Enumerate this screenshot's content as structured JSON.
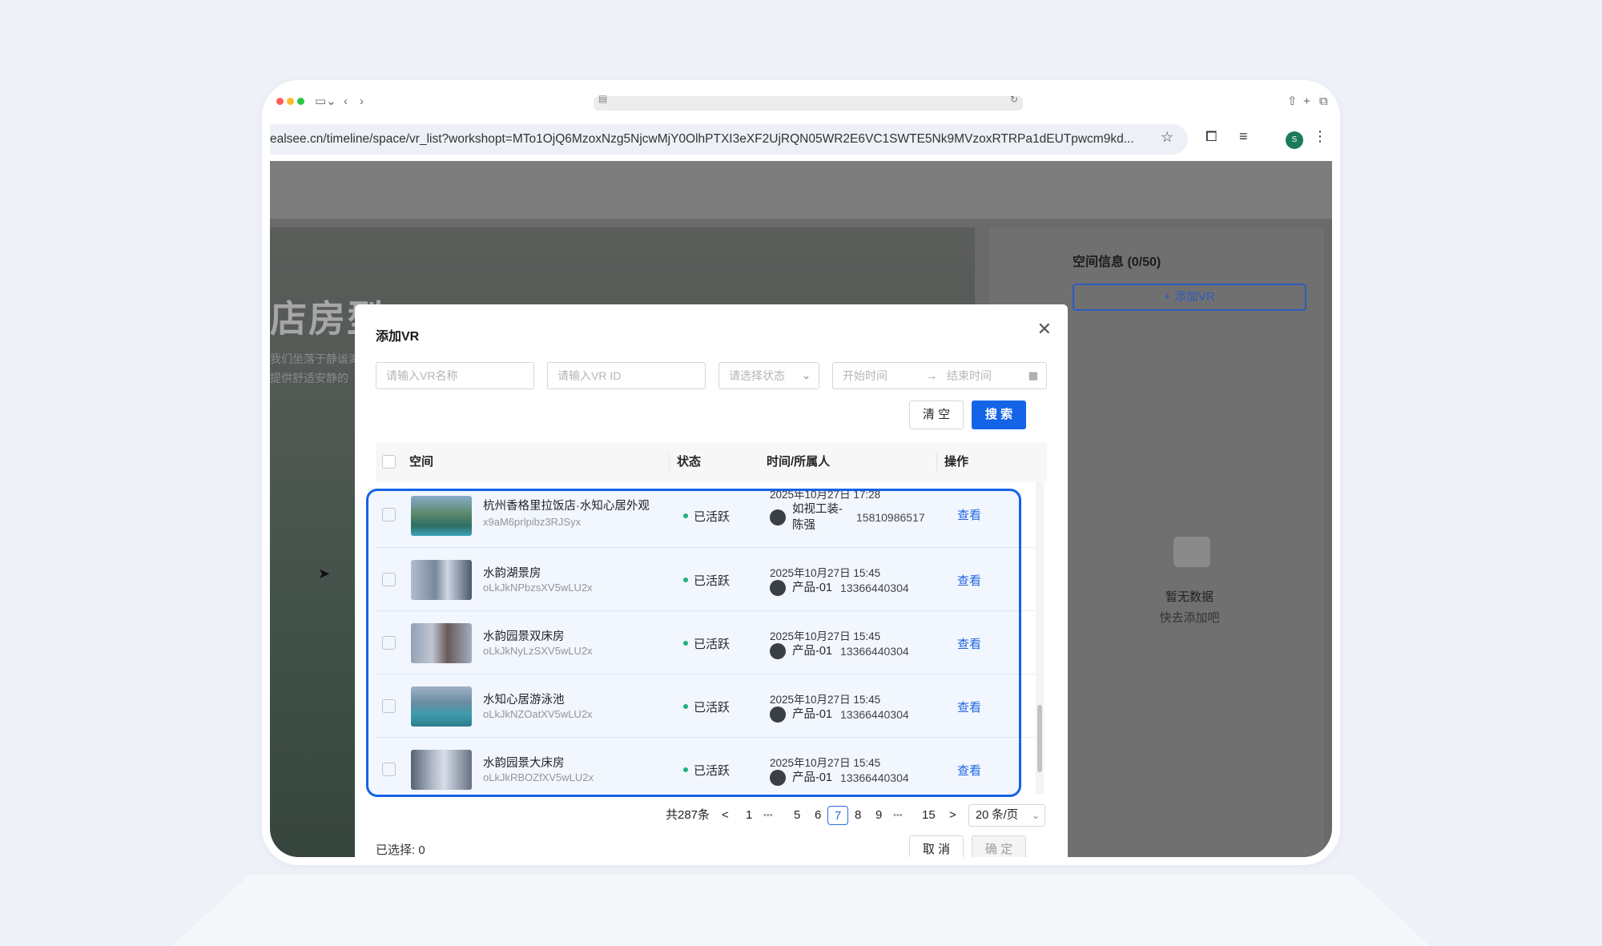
{
  "browser": {
    "url": "ealsee.cn/timeline/space/vr_list?workshopt=MTo1OjQ6MzoxNzg5NjcwMjY0OlhPTXI3eXF2UjRQN05WR2E6VC1SWTE5Nk9MVzoxRTRPa1dEUTpwcm9kd...",
    "profile_initial": "S",
    "colors": {
      "close": "#ff5f57",
      "minimize": "#febc2e",
      "maximize": "#28c840"
    }
  },
  "background_page": {
    "hero_title": "店房型",
    "hero_sub_line1": "我们坐落于静谧湖",
    "hero_sub_line2": "提供舒适安静的",
    "panel_title": "空间信息 (0/50)",
    "add_vr_label": "添加VR",
    "empty_title": "暂无数据",
    "empty_hint": "快去添加吧"
  },
  "modal": {
    "title": "添加VR",
    "filters": {
      "name_placeholder": "请输入VR名称",
      "id_placeholder": "请输入VR ID",
      "status_placeholder": "请选择状态",
      "start_placeholder": "开始时间",
      "end_placeholder": "结束时间"
    },
    "clear_label": "清 空",
    "search_label": "搜 索",
    "columns": {
      "space": "空间",
      "status": "状态",
      "time_owner": "时间/所属人",
      "action": "操作"
    },
    "rows": [
      {
        "name": "杭州香格里拉饭店·水知心居外观",
        "id": "x9aM6prlpibz3RJSyx",
        "status": "已活跃",
        "time": "2025年10月27日 17:28",
        "owner": "如视工装-",
        "owner2": "陈强",
        "phone": "15810986517",
        "action": "查看"
      },
      {
        "name": "水韵湖景房",
        "id": "oLkJkNPbzsXV5wLU2x",
        "status": "已活跃",
        "time": "2025年10月27日 15:45",
        "owner": "产品-01",
        "phone": "13366440304",
        "action": "查看"
      },
      {
        "name": "水韵园景双床房",
        "id": "oLkJkNyLzSXV5wLU2x",
        "status": "已活跃",
        "time": "2025年10月27日 15:45",
        "owner": "产品-01",
        "phone": "13366440304",
        "action": "查看"
      },
      {
        "name": "水知心居游泳池",
        "id": "oLkJkNZOatXV5wLU2x",
        "status": "已活跃",
        "time": "2025年10月27日 15:45",
        "owner": "产品-01",
        "phone": "13366440304",
        "action": "查看"
      },
      {
        "name": "水韵园景大床房",
        "id": "oLkJkRBOZfXV5wLU2x",
        "status": "已活跃",
        "time": "2025年10月27日 15:45",
        "owner": "产品-01",
        "phone": "13366440304",
        "action": "查看"
      }
    ],
    "pagination": {
      "total": "共287条",
      "prev": "<",
      "next": ">",
      "pages": [
        "1",
        "•••",
        "5",
        "6",
        "7",
        "8",
        "9",
        "•••",
        "15"
      ],
      "current": "7",
      "page_size": "20 条/页"
    },
    "selected_label": "已选择: 0",
    "cancel_label": "取 消",
    "confirm_label": "确 定"
  },
  "accent_color": "#1564e8"
}
